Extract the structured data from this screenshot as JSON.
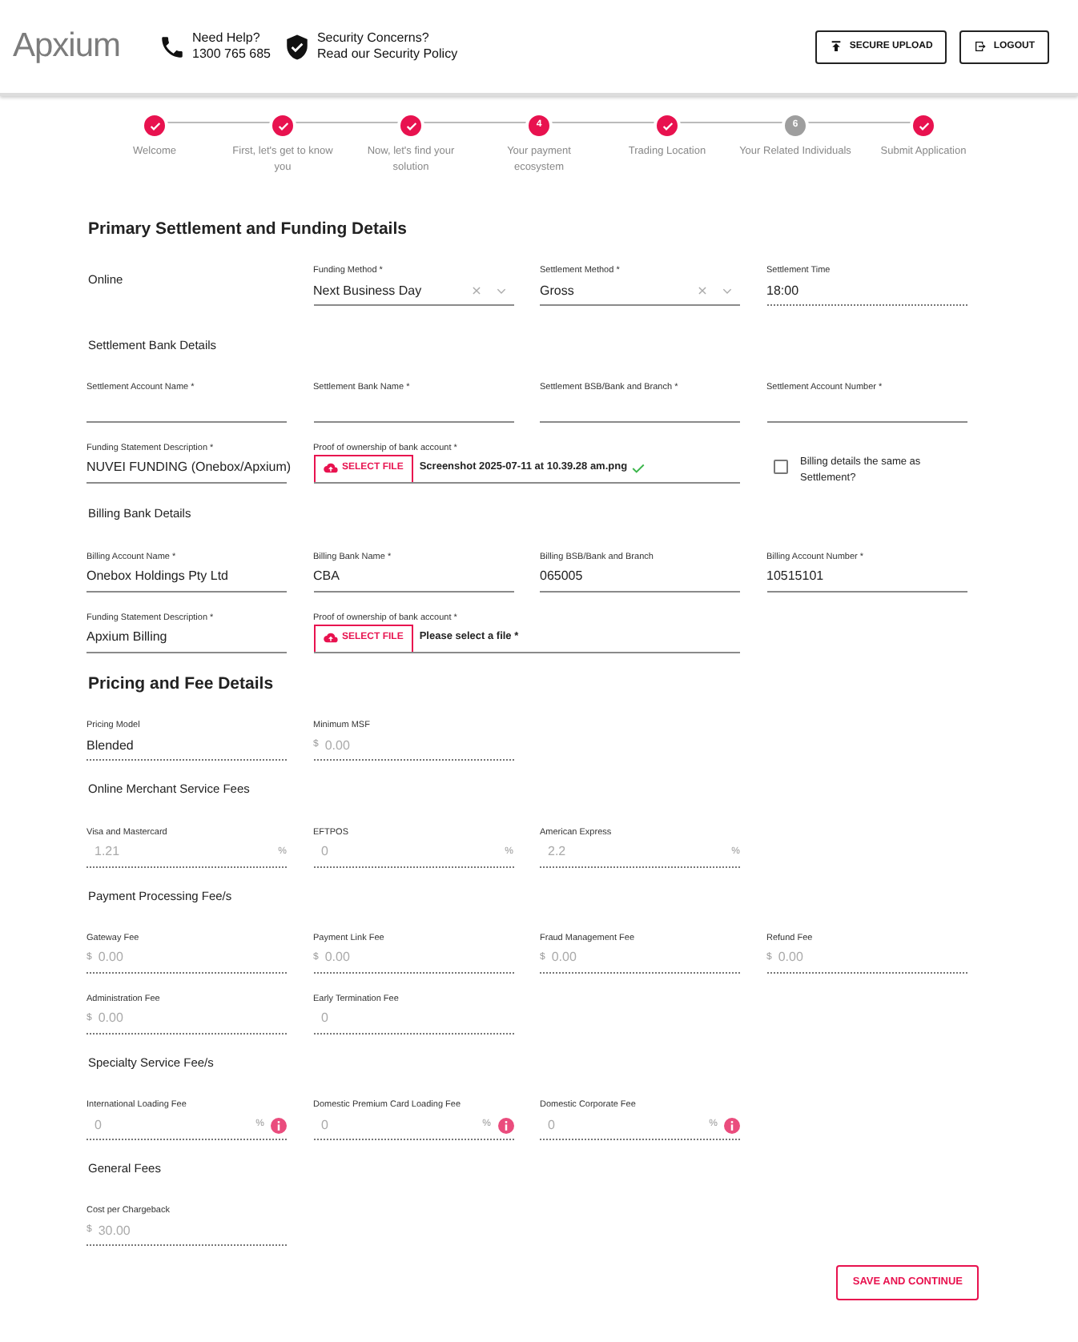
{
  "header": {
    "logo": "Apxium",
    "help": {
      "title": "Need Help?",
      "phone": "1300 765 685"
    },
    "security": {
      "title": "Security Concerns?",
      "link": "Read our Security Policy"
    },
    "buttons": [
      {
        "kind": "upload",
        "label": "SECURE UPLOAD"
      },
      {
        "kind": "logout",
        "label": "LOGOUT"
      }
    ]
  },
  "steps": [
    {
      "label": "Welcome",
      "completed": true,
      "color": "#e8124f"
    },
    {
      "label": "First, let's get to know you",
      "completed": true,
      "color": "#e8124f"
    },
    {
      "label": "Now, let's find your solution",
      "completed": true,
      "color": "#e8124f"
    },
    {
      "label": "Your payment ecosystem",
      "completed": false,
      "color": "#e8124f",
      "number": "4"
    },
    {
      "label": "Trading Location",
      "completed": true,
      "color": "#e8124f"
    },
    {
      "label": "Your Related Individuals",
      "completed": false,
      "color": "#9e9e9e",
      "number": "6"
    },
    {
      "label": "Submit Application",
      "completed": true,
      "color": "#e8124f"
    }
  ],
  "blocks": [
    {
      "kind": "title",
      "text": "Primary Settlement and Funding Details"
    },
    {
      "kind": "row",
      "fields": [
        {
          "kind": "static",
          "text": "Online"
        },
        {
          "kind": "select",
          "label": "Funding Method *",
          "value": "Next Business Day"
        },
        {
          "kind": "select",
          "label": "Settlement Method *",
          "value": "Gross"
        },
        {
          "kind": "readonly",
          "label": "Settlement Time",
          "value": "18:00",
          "disabled": false
        }
      ]
    },
    {
      "kind": "subtitle",
      "text": "Settlement Bank Details"
    },
    {
      "kind": "row",
      "fields": [
        {
          "kind": "text",
          "label": "Settlement Account Name *"
        },
        {
          "kind": "text",
          "label": "Settlement Bank Name *"
        },
        {
          "kind": "text",
          "label": "Settlement BSB/Bank and Branch *"
        },
        {
          "kind": "text",
          "label": "Settlement Account Number *"
        }
      ]
    },
    {
      "kind": "row",
      "fields": [
        {
          "kind": "text",
          "label": "Funding Statement Description *",
          "value": "NUVEI FUNDING (Onebox/Apxium)"
        },
        {
          "kind": "file",
          "label": "Proof of ownership of bank account *",
          "button": "SELECT FILE",
          "file": "Screenshot 2025-07-11 at 10.39.28 am.png",
          "uploaded": true
        },
        {
          "kind": "checkbox",
          "label": "Billing details the same as Settlement?",
          "checked": false
        }
      ]
    },
    {
      "kind": "subtitle",
      "text": "Billing Bank Details"
    },
    {
      "kind": "row",
      "fields": [
        {
          "kind": "text",
          "label": "Billing Account Name *",
          "value": "Onebox Holdings Pty Ltd"
        },
        {
          "kind": "text",
          "label": "Billing Bank Name *",
          "value": "CBA"
        },
        {
          "kind": "text",
          "label": "Billing BSB/Bank and Branch",
          "value": "065005"
        },
        {
          "kind": "text",
          "label": "Billing Account Number *",
          "value": "10515101"
        }
      ]
    },
    {
      "kind": "row",
      "fields": [
        {
          "kind": "text",
          "label": "Funding Statement Description *",
          "value": "Apxium Billing"
        },
        {
          "kind": "file",
          "label": "Proof of ownership of bank account *",
          "button": "SELECT FILE",
          "file": "Please select a file *",
          "uploaded": false
        }
      ]
    },
    {
      "kind": "title",
      "text": "Pricing and Fee Details"
    },
    {
      "kind": "row",
      "fields": [
        {
          "kind": "readonly",
          "label": "Pricing Model",
          "value": "Blended",
          "disabled": false
        },
        {
          "kind": "readonly",
          "label": "Minimum MSF",
          "prefix": "$",
          "value": "0.00",
          "disabled": true
        }
      ]
    },
    {
      "kind": "subtitle",
      "text": "Online Merchant Service Fees"
    },
    {
      "kind": "row",
      "fields": [
        {
          "kind": "readonly",
          "label": "Visa and Mastercard",
          "value": "1.21",
          "suffix": "%",
          "disabled": true
        },
        {
          "kind": "readonly",
          "label": "EFTPOS",
          "value": "0",
          "suffix": "%",
          "disabled": true
        },
        {
          "kind": "readonly",
          "label": "American Express",
          "value": "2.2",
          "suffix": "%",
          "disabled": true
        }
      ]
    },
    {
      "kind": "subtitle",
      "text": "Payment Processing Fee/s"
    },
    {
      "kind": "row",
      "fields": [
        {
          "kind": "readonly",
          "label": "Gateway Fee",
          "prefix": "$",
          "value": "0.00",
          "disabled": true
        },
        {
          "kind": "readonly",
          "label": "Payment Link Fee",
          "prefix": "$",
          "value": "0.00",
          "disabled": true
        },
        {
          "kind": "readonly",
          "label": "Fraud Management Fee",
          "prefix": "$",
          "value": "0.00",
          "disabled": true
        },
        {
          "kind": "readonly",
          "label": "Refund Fee",
          "prefix": "$",
          "value": "0.00",
          "disabled": true
        }
      ]
    },
    {
      "kind": "row",
      "fields": [
        {
          "kind": "readonly",
          "label": "Administration Fee",
          "prefix": "$",
          "value": "0.00",
          "disabled": true
        },
        {
          "kind": "readonly",
          "label": "Early Termination Fee",
          "value": "0",
          "disabled": true
        }
      ]
    },
    {
      "kind": "subtitle",
      "text": "Specialty Service Fee/s"
    },
    {
      "kind": "row",
      "fields": [
        {
          "kind": "readonly",
          "label": "International Loading Fee",
          "value": "0",
          "suffix": "%",
          "info": true,
          "disabled": true
        },
        {
          "kind": "readonly",
          "label": "Domestic Premium Card Loading Fee",
          "value": "0",
          "suffix": "%",
          "info": true,
          "disabled": true
        },
        {
          "kind": "readonly",
          "label": "Domestic Corporate Fee",
          "value": "0",
          "suffix": "%",
          "info": true,
          "disabled": true
        }
      ]
    },
    {
      "kind": "subtitle",
      "text": "General Fees"
    },
    {
      "kind": "row",
      "fields": [
        {
          "kind": "readonly",
          "label": "Cost per Chargeback",
          "prefix": "$",
          "value": "30.00",
          "disabled": true
        }
      ]
    }
  ],
  "save_button": "SAVE AND CONTINUE"
}
